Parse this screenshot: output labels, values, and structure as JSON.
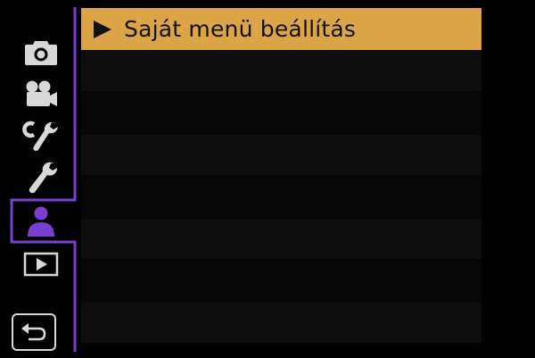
{
  "colors": {
    "accent": "#dba447",
    "active_tab": "#7a3fd1",
    "icon": "#d8d8d8",
    "background": "#000000"
  },
  "sidebar": {
    "tabs": [
      {
        "icon": "camera-icon",
        "active": false
      },
      {
        "icon": "video-camera-icon",
        "active": false
      },
      {
        "icon": "custom-settings-icon",
        "active": false
      },
      {
        "icon": "setup-wrench-icon",
        "active": false
      },
      {
        "icon": "my-menu-person-icon",
        "active": true
      },
      {
        "icon": "playback-icon",
        "active": false
      }
    ],
    "back": {
      "icon": "back-arrow-icon"
    }
  },
  "menu": {
    "items": [
      {
        "label": "Saját menü beállítás",
        "selected": true
      }
    ]
  }
}
